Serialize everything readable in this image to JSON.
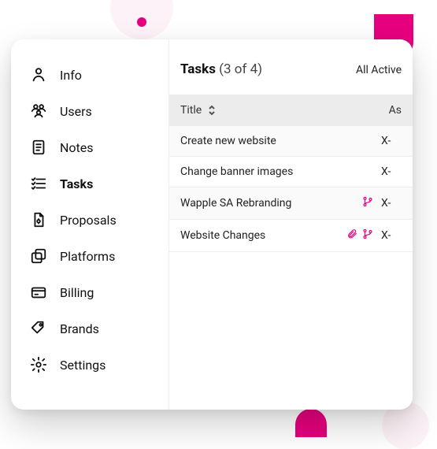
{
  "sidebar": {
    "items": [
      {
        "label": "Info",
        "icon": "user-icon"
      },
      {
        "label": "Users",
        "icon": "users-icon"
      },
      {
        "label": "Notes",
        "icon": "notes-icon"
      },
      {
        "label": "Tasks",
        "icon": "tasks-icon"
      },
      {
        "label": "Proposals",
        "icon": "proposals-icon"
      },
      {
        "label": "Platforms",
        "icon": "platforms-icon"
      },
      {
        "label": "Billing",
        "icon": "billing-icon"
      },
      {
        "label": "Brands",
        "icon": "brands-icon"
      },
      {
        "label": "Settings",
        "icon": "settings-icon"
      }
    ],
    "active_index": 3
  },
  "main": {
    "title": "Tasks",
    "count": "(3 of 4)",
    "filter": "All Active",
    "columns": {
      "title": "Title",
      "assignee": "As"
    },
    "rows": [
      {
        "title": "Create new website",
        "assignee": "X-",
        "attach": false,
        "branch": false
      },
      {
        "title": "Change banner images",
        "assignee": "X-",
        "attach": false,
        "branch": false
      },
      {
        "title": "Wapple SA Rebranding",
        "assignee": "X-",
        "attach": false,
        "branch": true
      },
      {
        "title": "Website Changes",
        "assignee": "X-",
        "attach": true,
        "branch": true
      }
    ]
  },
  "colors": {
    "accent": "#e6007e"
  }
}
